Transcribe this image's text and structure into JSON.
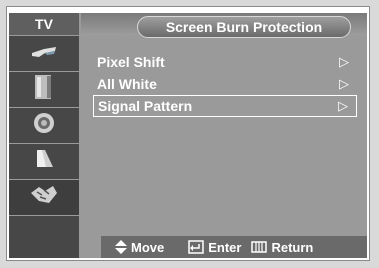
{
  "header": {
    "section_label": "TV",
    "title": "Screen Burn Protection"
  },
  "sidebar": {
    "items": [
      {
        "icon": "picture-icon"
      },
      {
        "icon": "sound-icon"
      },
      {
        "icon": "channel-icon"
      },
      {
        "icon": "setup-icon"
      },
      {
        "icon": "input-icon"
      }
    ]
  },
  "menu": {
    "items": [
      {
        "label": "Pixel Shift",
        "arrow": "▷"
      },
      {
        "label": "All White",
        "arrow": "▷"
      },
      {
        "label": "Signal Pattern",
        "arrow": "▷",
        "selected": true
      }
    ]
  },
  "help": {
    "move": "Move",
    "enter": "Enter",
    "return": "Return"
  },
  "colors": {
    "panel": "#9a9a9a",
    "sidebar": "#474747",
    "helpbar": "#6a6a6a"
  }
}
